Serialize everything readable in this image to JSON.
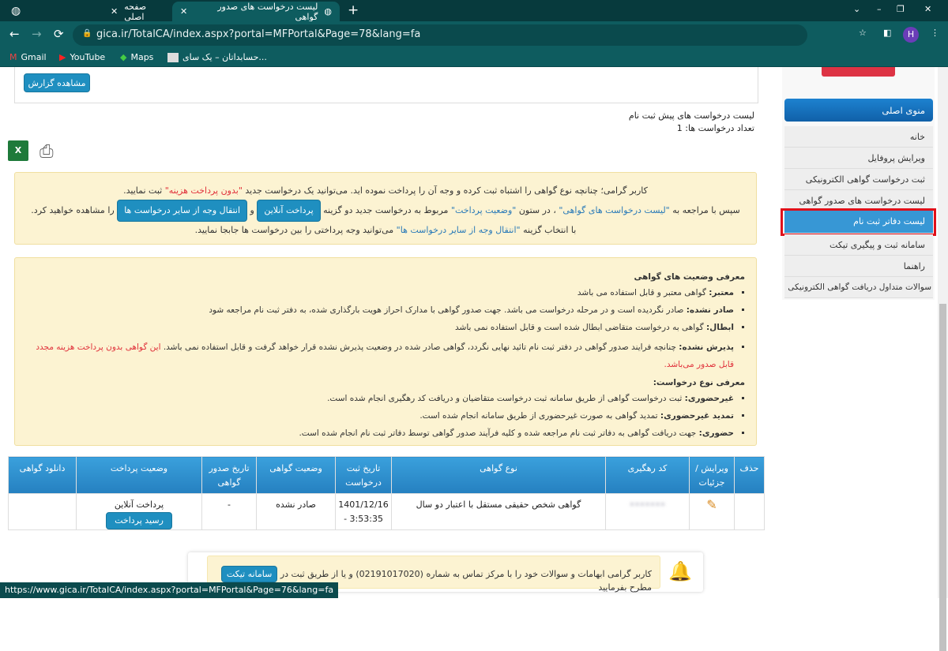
{
  "browser": {
    "tabs": [
      {
        "title": "صفحه اصلی"
      },
      {
        "title": "لیست درخواست های صدور گواهی",
        "active": true
      }
    ],
    "url": "gica.ir/TotalCA/index.aspx?portal=MFPortal&Page=78&lang=fa",
    "bookmarks": [
      "Gmail",
      "YouTube",
      "Maps",
      "حسابداتان – یک سای..."
    ],
    "profile_initial": "H",
    "status_url": "https://www.gica.ir/TotalCA/index.aspx?portal=MFPortal&Page=76&lang=fa"
  },
  "report": {
    "view_button": "مشاهده گزارش",
    "list_title": "لیست درخواست های پیش ثبت نام",
    "count_label": "تعداد درخواست ها: 1"
  },
  "notice1": {
    "l1a": "کاربر گرامی؛ چنانچه نوع گواهی را اشتباه ثبت کرده و وجه آن را پرداخت نموده اید. می‌توانید یک درخواست جدید ",
    "l1b": "\"بدون پرداخت هزینه\"",
    "l1c": " ثبت نمایید.",
    "l2a": "سپس با مراجعه به ",
    "l2b": "\"لیست درخواست های گواهی\"",
    "l2c": " ، در ستون ",
    "l2d": "\"وضعیت پرداخت\"",
    "l2e": " مربوط به درخواست جدید دو گزینه ",
    "btn_online": "پرداخت آنلاین",
    "and": " و ",
    "btn_transfer": "انتقال وجه از سایر درخواست ها",
    "l2f": " را مشاهده خواهید کرد.",
    "l3a": "با انتخاب گزینه ",
    "l3b": "\"انتقال وجه از سایر درخواست ها\"",
    "l3c": " می‌توانید وجه پرداختی را بین درخواست ها جابجا نمایید."
  },
  "notice2": {
    "status_title": "معرفی وضعیت های گواهی",
    "statuses": [
      {
        "k": "معتبر:",
        "v": " گواهی معتبر و قابل استفاده می باشد"
      },
      {
        "k": "صادر نشده:",
        "v": " صادر نگردیده است و در مرحله درخواست می باشد. جهت صدور گواهی با مدارک احراز هویت بارگذاری شده، به دفتر ثبت نام مراجعه شود"
      },
      {
        "k": "ابطال:",
        "v": " گواهی به درخواست متقاضی ابطال شده است و قابل استفاده نمی باشد"
      },
      {
        "k": "پذیرش نشده:",
        "v": " چنانچه فرایند صدور گواهی در دفتر ثبت نام تائید نهایی نگردد، گواهی صادر شده در وضعیت پذیرش نشده قرار خواهد گرفت و قابل استفاده نمی باشد. ",
        "red": "این گواهی بدون پرداخت هزینه مجدد قابل صدور می‌باشد."
      }
    ],
    "type_title": "معرفی نوع درخواست:",
    "types": [
      {
        "k": "غیرحضوری:",
        "v": " ثبت درخواست گواهی از طریق سامانه ثبت درخواست متقاضیان و دریافت کد رهگیری انجام شده است."
      },
      {
        "k": "تمدید غیرحضوری:",
        "v": " تمدید گواهی به صورت غیرحضوری از طریق سامانه انجام شده است."
      },
      {
        "k": "حضوری:",
        "v": " جهت دریافت گواهی به دفاتر ثبت نام مراجعه شده و کلیه فرآیند صدور گواهی توسط دفاتر ثبت نام انجام شده است."
      }
    ]
  },
  "table": {
    "headers": [
      "حذف",
      "ویرایش / جزئیات",
      "کد رهگیری",
      "نوع گواهی",
      "تاریخ ثبت درخواست",
      "وضعیت گواهی",
      "تاریخ صدور گواهی",
      "وضعیت پرداخت",
      "دانلود گواهی"
    ],
    "rows": [
      {
        "tracking": "•••••••",
        "type": "گواهی شخص حقیقی مستقل با اعتبار دو سال",
        "date": "1401/12/16",
        "time": "3:53:35 -",
        "status": "صادر نشده",
        "issue_date": "-",
        "payment": "پرداخت آنلاین",
        "receipt_button": "رسید پرداخت"
      }
    ]
  },
  "footer": {
    "a": "کاربر گرامی ابهامات و سوالات خود را با مرکز تماس به شماره (02191017020) و یا از طریق ثبت در ",
    "button": "سامانه تیکت",
    "b": " مطرح بفرمایید"
  },
  "sidebar": {
    "header": "منوی اصلی",
    "items": [
      "خانه",
      "ویرایش پروفایل",
      "ثبت درخواست گواهی الکترونیکی",
      "لیست درخواست های صدور گواهی",
      "لیست دفاتر ثبت نام",
      "سامانه ثبت و پیگیری تیکت",
      "راهنما",
      "سوالات متداول دریافت گواهی الکترونیکی"
    ],
    "active_index": 4
  },
  "colors": {
    "chrome": "#0e5c5f",
    "accent": "#1f8fc0",
    "notice_bg": "#fcf3d2",
    "highlight": "#e0101a"
  }
}
